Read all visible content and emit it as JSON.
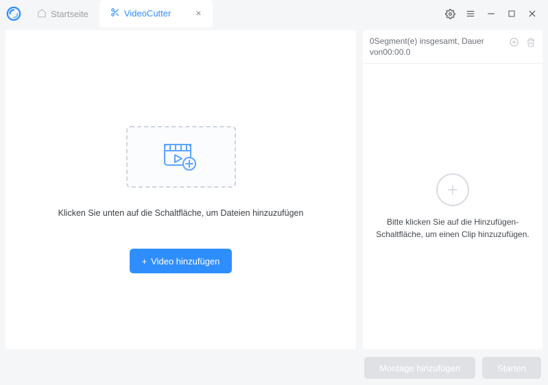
{
  "tabs": {
    "home": {
      "label": "Startseite"
    },
    "cutter": {
      "label": "VideoCutter"
    }
  },
  "main": {
    "hint": "Klicken Sie unten auf die Schaltfläche, um Dateien hinzuzufügen",
    "add_button": "Video hinzufügen"
  },
  "side": {
    "summary_line1": "0Segment(e) insgesamt, Dauer",
    "summary_line2": "von00:00.0",
    "hint_line1": "Bitte klicken Sie auf die Hinzufügen-",
    "hint_line2": "Schaltfläche, um einen Clip hinzuzufügen."
  },
  "footer": {
    "montage": "Montage hinzufügen",
    "start": "Starten"
  },
  "colors": {
    "accent": "#2f8eff"
  }
}
